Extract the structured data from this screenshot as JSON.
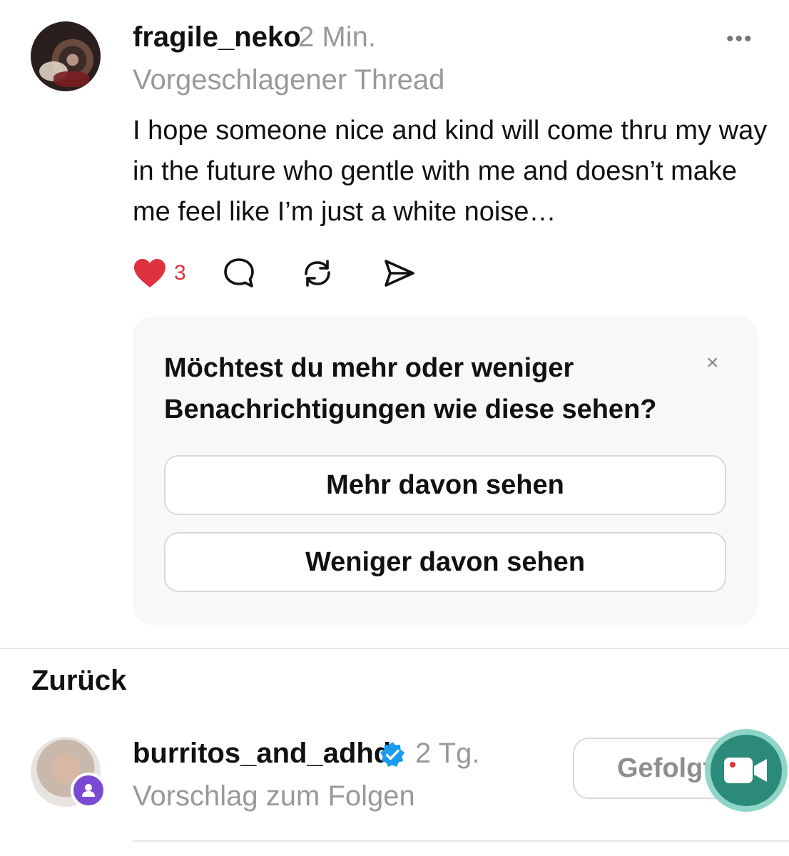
{
  "post": {
    "username": "fragile_neko",
    "time": "2 Min.",
    "subline": "Vorgeschlagener Thread",
    "more_label": "•••",
    "text": "I hope someone nice and kind will come thru my way in the future who gentle with me and doesn’t make me feel like I’m just a white noise…",
    "likes": "3",
    "icons": {
      "like": "heart-icon",
      "comment": "comment-icon",
      "repost": "repost-icon",
      "share": "send-icon"
    },
    "colors": {
      "like": "#e0323e"
    }
  },
  "feedback": {
    "question": "Möchtest du mehr oder weniger Benachrichtigungen wie diese sehen?",
    "close_label": "×",
    "more_button": "Mehr davon sehen",
    "less_button": "Weniger davon sehen"
  },
  "section": {
    "back_label": "Zurück"
  },
  "suggestion": {
    "username": "burritos_and_adhd",
    "time": "2 Tg.",
    "subline": "Vorschlag zum Folgen",
    "follow_label": "Gefolgt",
    "icons": {
      "badge": "person-icon",
      "verified": "verified-icon",
      "fab": "video-camera-icon"
    },
    "colors": {
      "badge": "#7a4bd2",
      "verified": "#1d9bf0",
      "fab": "#2c8a7b"
    }
  }
}
